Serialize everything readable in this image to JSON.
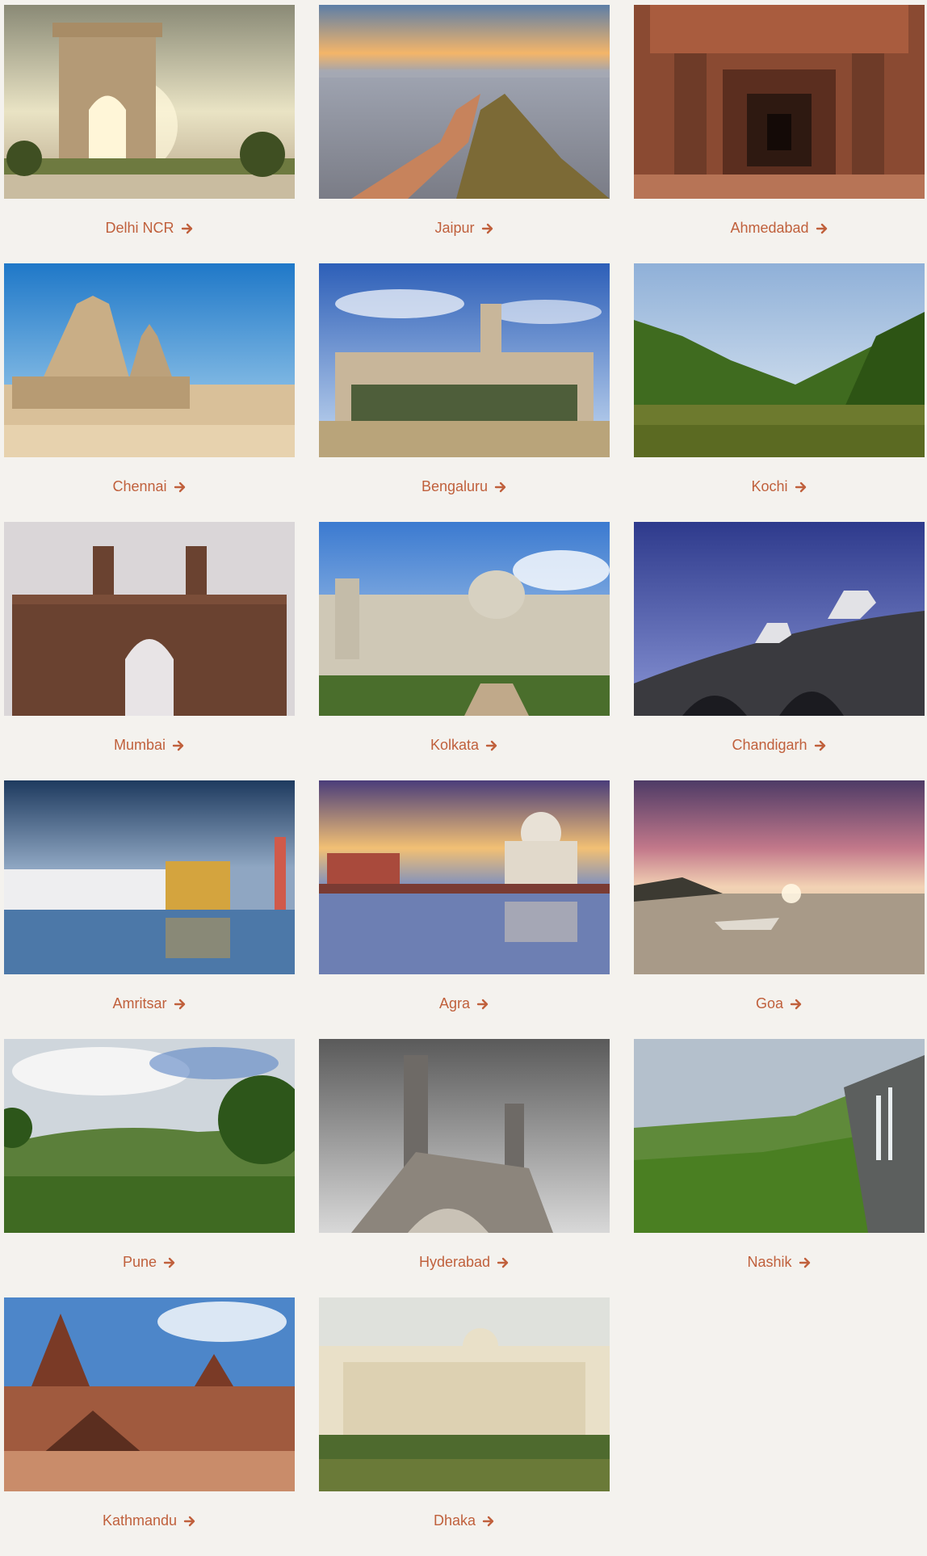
{
  "link_color": "#c0603c",
  "cities": [
    {
      "name": "Delhi NCR",
      "icon": "arrow-right-icon"
    },
    {
      "name": "Jaipur",
      "icon": "arrow-right-icon"
    },
    {
      "name": "Ahmedabad",
      "icon": "arrow-right-icon"
    },
    {
      "name": "Chennai",
      "icon": "arrow-right-icon"
    },
    {
      "name": "Bengaluru",
      "icon": "arrow-right-icon"
    },
    {
      "name": "Kochi",
      "icon": "arrow-right-icon"
    },
    {
      "name": "Mumbai",
      "icon": "arrow-right-icon"
    },
    {
      "name": "Kolkata",
      "icon": "arrow-right-icon"
    },
    {
      "name": "Chandigarh",
      "icon": "arrow-right-icon"
    },
    {
      "name": "Amritsar",
      "icon": "arrow-right-icon"
    },
    {
      "name": "Agra",
      "icon": "arrow-right-icon"
    },
    {
      "name": "Goa",
      "icon": "arrow-right-icon"
    },
    {
      "name": "Pune",
      "icon": "arrow-right-icon"
    },
    {
      "name": "Hyderabad",
      "icon": "arrow-right-icon"
    },
    {
      "name": "Nashik",
      "icon": "arrow-right-icon"
    },
    {
      "name": "Kathmandu",
      "icon": "arrow-right-icon"
    },
    {
      "name": "Dhaka",
      "icon": "arrow-right-icon"
    }
  ]
}
